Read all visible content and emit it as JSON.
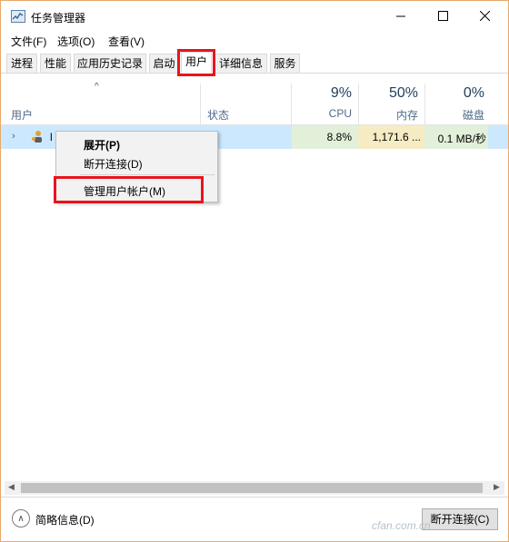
{
  "window": {
    "title": "任务管理器"
  },
  "menubar": {
    "items": [
      {
        "label": "文件(F)"
      },
      {
        "label": "选项(O)"
      },
      {
        "label": "查看(V)"
      }
    ]
  },
  "tabs": [
    {
      "label": "进程"
    },
    {
      "label": "性能"
    },
    {
      "label": "应用历史记录"
    },
    {
      "label": "启动"
    },
    {
      "label": "用户",
      "active": true
    },
    {
      "label": "详细信息"
    },
    {
      "label": "服务"
    }
  ],
  "columns": {
    "user": "用户",
    "status": "状态",
    "cpu": {
      "pct": "9%",
      "label": "CPU"
    },
    "memory": {
      "pct": "50%",
      "label": "内存"
    },
    "disk": {
      "pct": "0%",
      "label": "磁盘"
    }
  },
  "row": {
    "name": "l",
    "cpu": "8.8%",
    "memory": "1,171.6 ...",
    "disk": "0.1 MB/秒"
  },
  "context_menu": {
    "expand": "展开(P)",
    "disconnect": "断开连接(D)",
    "manage": "管理用户帐户(M)"
  },
  "footer": {
    "fewer_details": "简略信息(D)",
    "disconnect_button": "断开连接(C)",
    "watermark": "cfan.com.cn"
  },
  "colors": {
    "highlight_red": "#e8141e",
    "row_selected": "#cce8ff",
    "window_border": "#e8a86c"
  }
}
